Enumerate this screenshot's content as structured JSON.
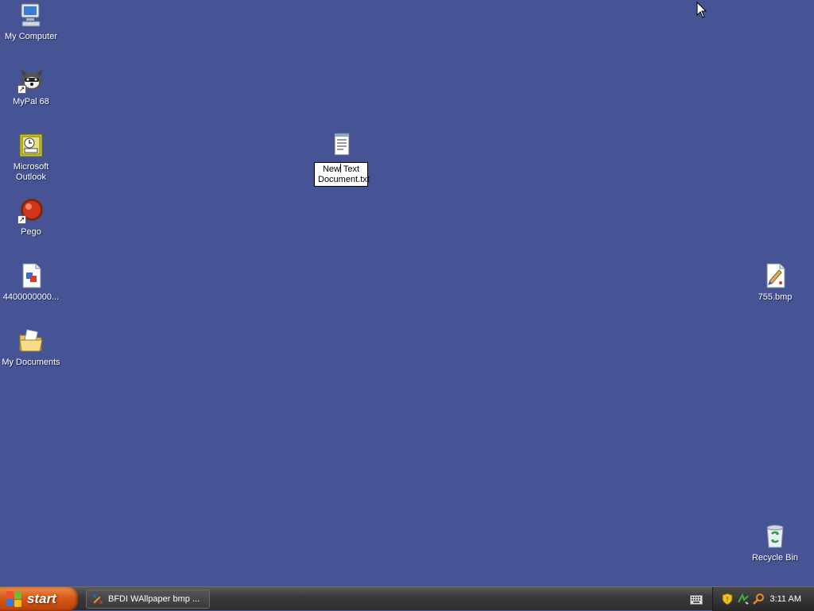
{
  "desktop": {
    "background_color": "#465394",
    "icons": {
      "my_computer": "My Computer",
      "mypal": "MyPal 68",
      "outlook": "Microsoft Outlook",
      "pego": "Pego",
      "file_440": "4400000000...",
      "my_documents": "My Documents",
      "bmp_755": "755.bmp",
      "recycle_bin": "Recycle Bin"
    },
    "rename": {
      "before_caret": "New",
      "after_caret": " Text Document.txt"
    }
  },
  "taskbar": {
    "start_label": "start",
    "task_button_label": "BFDI WAllpaper bmp ...",
    "clock": "3:11 AM"
  },
  "icons": {
    "my_computer": "computer-icon",
    "mypal": "mypal-browser-icon",
    "outlook": "outlook-icon",
    "pego": "pego-icon",
    "file_440": "image-file-icon",
    "my_documents": "folder-icon",
    "text_doc": "notepad-document-icon",
    "bmp_755": "paint-bitmap-icon",
    "recycle_bin": "recycle-bin-icon"
  }
}
